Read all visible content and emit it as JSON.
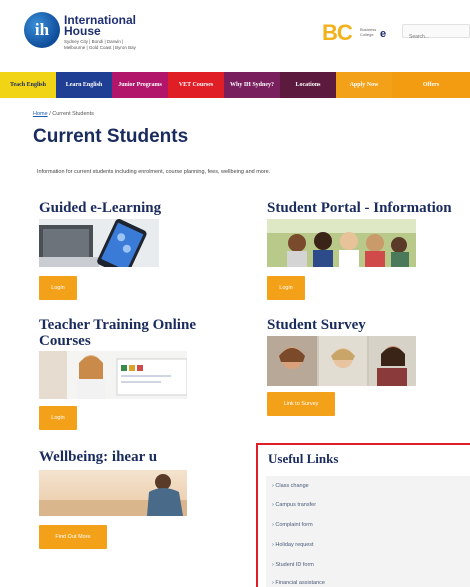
{
  "header": {
    "logo_mark": "ih",
    "logo_name": "International House",
    "logo_cities": "Sydney City | Bondi | Darwin | Melbourne | Gold Coast | Byron Bay",
    "bc_mark": "BC",
    "bc_sub": "Business College",
    "bc_e": "e",
    "search_placeholder": "Search..."
  },
  "nav": [
    {
      "label": "Teach English",
      "color": "#f2d416",
      "text_color": "#1a2b5e"
    },
    {
      "label": "Learn English",
      "color": "#1f3f95",
      "text_color": "#ffffff"
    },
    {
      "label": "Junior Programs",
      "color": "#b2166b",
      "text_color": "#ffffff"
    },
    {
      "label": "VET Courses",
      "color": "#e01e26",
      "text_color": "#ffffff"
    },
    {
      "label": "Why IH Sydney?",
      "color": "#7a1f5e",
      "text_color": "#ffffff"
    },
    {
      "label": "Locations",
      "color": "#5c1a3e",
      "text_color": "#ffffff"
    },
    {
      "label": "Apply Now",
      "color": "#f4a11a",
      "text_color": "#ffffff"
    },
    {
      "label": "Offers",
      "color": "#f39c12",
      "text_color": "#ffffff"
    }
  ],
  "breadcrumb": {
    "home": "Home",
    "separator": " / ",
    "current": "Current Students"
  },
  "page_title": "Current Students",
  "intro": "Information for current students including enrolment, course planning, fees, wellbeing and more.",
  "sections": {
    "guided": {
      "title": "Guided e-Learning",
      "button": "Login"
    },
    "portal": {
      "title": "Student Portal - Information",
      "button": "Login"
    },
    "teacher": {
      "title": "Teacher Training Online Courses",
      "button": "Login"
    },
    "survey": {
      "title": "Student Survey",
      "button": "Link to Survey"
    },
    "wellbeing": {
      "title": "Wellbeing: ihear u",
      "button": "Find Out More"
    }
  },
  "useful_links": {
    "title": "Useful Links",
    "items": [
      "Class change",
      "Campus transfer",
      "Complaint form",
      "Holiday request",
      "Student ID form",
      "Financial assistance"
    ]
  },
  "colors": {
    "brand_navy": "#1a2b5e",
    "accent_orange": "#f4a11a",
    "highlight_red": "#e01e26"
  }
}
